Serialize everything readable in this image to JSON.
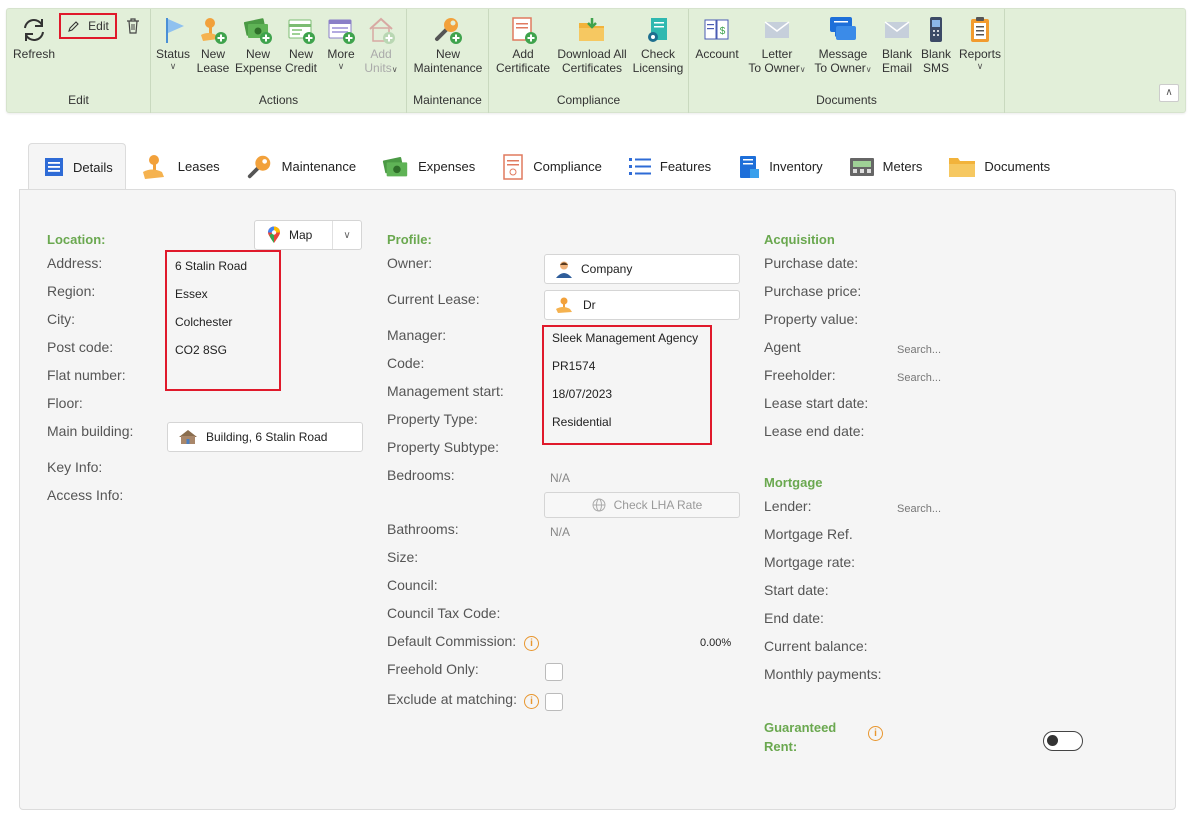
{
  "ribbon": {
    "edit_group": {
      "refresh": "Refresh",
      "edit": "Edit",
      "group": "Edit"
    },
    "actions": {
      "status": "Status",
      "new_lease": [
        "New",
        "Lease"
      ],
      "new_expense": [
        "New",
        "Expense"
      ],
      "new_credit": [
        "New",
        "Credit"
      ],
      "more": "More",
      "add_units": [
        "Add",
        "Units"
      ],
      "group": "Actions"
    },
    "maintenance": {
      "new_maintenance": [
        "New",
        "Maintenance"
      ],
      "group": "Maintenance"
    },
    "compliance": {
      "add_certificate": [
        "Add",
        "Certificate"
      ],
      "download_all": [
        "Download All",
        "Certificates"
      ],
      "check_licensing": [
        "Check",
        "Licensing"
      ],
      "group": "Compliance"
    },
    "documents": {
      "account": "Account",
      "letter": [
        "Letter",
        "To Owner"
      ],
      "message": [
        "Message",
        "To Owner"
      ],
      "blank_email": [
        "Blank",
        "Email"
      ],
      "blank_sms": [
        "Blank",
        "SMS"
      ],
      "reports": "Reports",
      "group": "Documents"
    }
  },
  "tabs": [
    {
      "label": "Details",
      "active": true
    },
    {
      "label": "Leases"
    },
    {
      "label": "Maintenance"
    },
    {
      "label": "Expenses"
    },
    {
      "label": "Compliance"
    },
    {
      "label": "Features"
    },
    {
      "label": "Inventory"
    },
    {
      "label": "Meters"
    },
    {
      "label": "Documents"
    }
  ],
  "location": {
    "title": "Location:",
    "map_button": "Map",
    "labels": {
      "address": "Address:",
      "region": "Region:",
      "city": "City:",
      "post_code": "Post code:",
      "flat_number": "Flat number:",
      "floor": "Floor:",
      "main_building": "Main building:",
      "key_info": "Key Info:",
      "access_info": "Access Info:"
    },
    "values": {
      "address": "6 Stalin Road",
      "region": "Essex",
      "city": "Colchester",
      "post_code": "CO2 8SG",
      "main_building": "Building, 6 Stalin Road"
    }
  },
  "profile": {
    "title": "Profile:",
    "labels": {
      "owner": "Owner:",
      "current_lease": "Current Lease:",
      "manager": "Manager:",
      "code": "Code:",
      "management_start": "Management start:",
      "property_type": "Property Type:",
      "property_subtype": "Property Subtype:",
      "bedrooms": "Bedrooms:",
      "bathrooms": "Bathrooms:",
      "size": "Size:",
      "council": "Council:",
      "council_tax_code": "Council Tax Code:",
      "default_commission": "Default Commission:",
      "freehold_only": "Freehold Only:",
      "exclude_matching": "Exclude at matching:"
    },
    "values": {
      "owner": "Company",
      "current_lease": "Dr",
      "manager": "Sleek Management Agency",
      "code": "PR1574",
      "management_start": "18/07/2023",
      "property_type": "Residential",
      "bedrooms": "N/A",
      "check_lha": "Check LHA Rate",
      "bathrooms": "N/A",
      "default_commission": "0.00%"
    }
  },
  "acquisition": {
    "title": "Acquisition",
    "labels": {
      "purchase_date": "Purchase date:",
      "purchase_price": "Purchase price:",
      "property_value": "Property value:",
      "agent": "Agent",
      "freeholder": "Freeholder:",
      "lease_start": "Lease start date:",
      "lease_end": "Lease end date:"
    },
    "search_placeholder": "Search..."
  },
  "mortgage": {
    "title": "Mortgage",
    "labels": {
      "lender": "Lender:",
      "ref": "Mortgage Ref.",
      "rate": "Mortgage rate:",
      "start": "Start date:",
      "end": "End date:",
      "balance": "Current balance:",
      "monthly": "Monthly payments:"
    },
    "search_placeholder": "Search..."
  },
  "guaranteed_rent": {
    "title_line1": "Guaranteed",
    "title_line2": "Rent:",
    "enabled": false
  },
  "icons": [
    "refresh-icon",
    "pencil-icon",
    "trash-icon",
    "flag-icon",
    "hand-key-icon",
    "money-icon",
    "credit-icon",
    "more-icon",
    "house-add-icon",
    "wrench-icon",
    "certificate-icon",
    "folder-download-icon",
    "license-icon",
    "ledger-icon",
    "envelope-icon",
    "chat-icon",
    "phone-icon",
    "clipboard-icon",
    "map-pin-icon",
    "building-icon",
    "person-icon",
    "globe-icon"
  ],
  "colors": {
    "ribbon_bg": "#e2efd9",
    "section_green": "#6aa84f",
    "highlight_red": "#e0192b",
    "info_orange": "#e8962e"
  }
}
